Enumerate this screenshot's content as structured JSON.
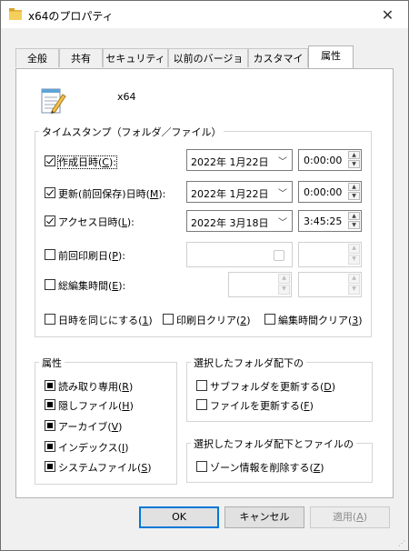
{
  "window": {
    "title": "x64のプロパティ",
    "close": "✕"
  },
  "tabs": [
    "全般",
    "共有",
    "セキュリティ",
    "以前のバージョン",
    "カスタマイズ",
    "属性"
  ],
  "active_tab": "属性",
  "file": {
    "name": "x64"
  },
  "timestamp": {
    "label": "タイムスタンプ（フォルダ／ファイル）",
    "rows": [
      {
        "label": "作成日時(",
        "key": "C",
        "suffix": "):",
        "checked": true,
        "date": "2022年  1月22日",
        "time": "0:00:00"
      },
      {
        "label": "更新(前回保存)日時(",
        "key": "M",
        "suffix": "):",
        "checked": true,
        "date": "2022年  1月22日",
        "time": "0:00:00"
      },
      {
        "label": "アクセス日時(",
        "key": "L",
        "suffix": "):",
        "checked": true,
        "date": "2022年  3月18日",
        "time": "3:45:25"
      },
      {
        "label": "前回印刷日(",
        "key": "P",
        "suffix": "):",
        "checked": false,
        "date": "",
        "time": ""
      },
      {
        "label": "総編集時間(",
        "key": "E",
        "suffix": "):",
        "checked": false,
        "date": "",
        "time": ""
      }
    ],
    "options": [
      {
        "label": "日時を同じにする(",
        "key": "1",
        "suffix": ")"
      },
      {
        "label": "印刷日クリア(",
        "key": "2",
        "suffix": ")"
      },
      {
        "label": "編集時間クリア(",
        "key": "3",
        "suffix": ")"
      }
    ]
  },
  "attributes": {
    "label": "属性",
    "items": [
      {
        "label": "読み取り専用(",
        "key": "R",
        "suffix": ")"
      },
      {
        "label": "隠しファイル(",
        "key": "H",
        "suffix": ")"
      },
      {
        "label": "アーカイブ(",
        "key": "V",
        "suffix": ")"
      },
      {
        "label": "インデックス(",
        "key": "I",
        "suffix": ")"
      },
      {
        "label": "システムファイル(",
        "key": "S",
        "suffix": ")"
      }
    ]
  },
  "folder_group": {
    "label": "選択したフォルダ配下の",
    "items": [
      {
        "label": "サブフォルダを更新する(",
        "key": "D",
        "suffix": ")"
      },
      {
        "label": "ファイルを更新する(",
        "key": "F",
        "suffix": ")"
      }
    ]
  },
  "zone_group": {
    "label": "選択したフォルダ配下とファイルの",
    "items": [
      {
        "label": "ゾーン情報を削除する(",
        "key": "Z",
        "suffix": ")"
      }
    ]
  },
  "buttons": {
    "ok": "OK",
    "cancel": "キャンセル",
    "apply": "適用(",
    "apply_key": "A",
    "apply_suffix": ")"
  }
}
